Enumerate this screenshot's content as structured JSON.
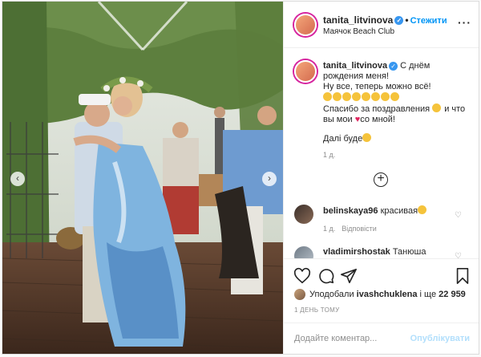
{
  "colors": {
    "accent": "#0095f6",
    "heart": "#e0245e",
    "muted": "#8e8e8e"
  },
  "header": {
    "username": "tanita_litvinova",
    "separator": "•",
    "follow_label": "Стежити",
    "location": "Маячок Beach Club",
    "more_icon": "more-options-icon"
  },
  "caption": {
    "username": "tanita_litvinova",
    "line1": "С днём рождения меня!",
    "line2": "Ну все, теперь можно всё!",
    "line3_emoji_count": 8,
    "line4a": "Спасибо за поздравления",
    "line4b": "и что вы мои",
    "line4c": "со мной!",
    "line5": "Далі буде",
    "time": "1 д."
  },
  "comments": [
    {
      "username": "belinskaya96",
      "text": "красивая",
      "time": "1 д.",
      "reply": "Відповісти"
    },
    {
      "username": "vladimirshostak",
      "text": "Танюша"
    }
  ],
  "actions": {
    "icons": [
      "heart-icon",
      "comment-icon",
      "share-icon",
      "bookmark-icon"
    ],
    "likes_prefix": "Уподобали",
    "likes_user": "ivashchuklena",
    "likes_middle": "і ще",
    "likes_count": "22 959",
    "date": "1 ДЕНЬ ТОМУ"
  },
  "add_comment": {
    "placeholder": "Додайте коментар...",
    "publish_label": "Опублікувати"
  },
  "carousel": {
    "prev": "‹",
    "next": "›"
  }
}
